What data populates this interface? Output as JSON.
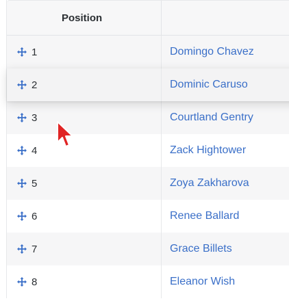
{
  "table": {
    "header": {
      "position": "Position",
      "name": ""
    },
    "rows": [
      {
        "position": "1",
        "name": "Domingo Chavez"
      },
      {
        "position": "2",
        "name": "Dominic Caruso"
      },
      {
        "position": "3",
        "name": "Courtland Gentry"
      },
      {
        "position": "4",
        "name": "Zack Hightower"
      },
      {
        "position": "5",
        "name": "Zoya Zakharova"
      },
      {
        "position": "6",
        "name": "Renee Ballard"
      },
      {
        "position": "7",
        "name": "Grace Billets"
      },
      {
        "position": "8",
        "name": "Eleanor Wish"
      }
    ]
  },
  "colors": {
    "link": "#3a6fc8",
    "handle": "#3a6fc8",
    "cursor": "#e02424"
  },
  "icons": {
    "drag_handle": "move-arrows-icon",
    "cursor": "mouse-pointer-icon"
  }
}
